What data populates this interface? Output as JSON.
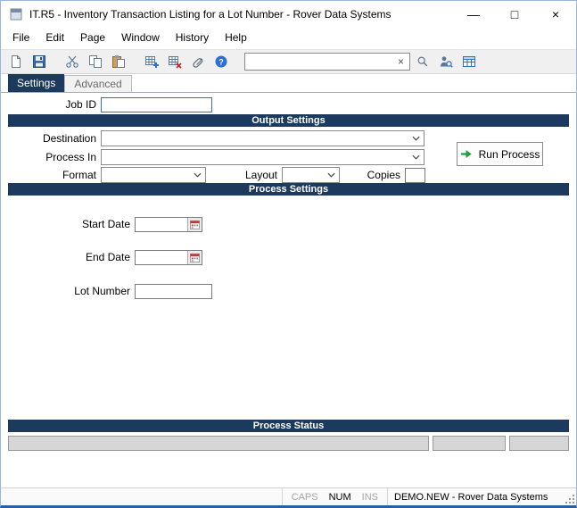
{
  "colors": {
    "header_navy": "#1B3A5E",
    "run_arrow_green": "#1E9E40"
  },
  "window": {
    "title": "IT.R5 - Inventory Transaction Listing for a Lot Number - Rover Data Systems",
    "minimize_glyph": "—",
    "maximize_glyph": "□",
    "close_glyph": "×"
  },
  "menu": {
    "items": [
      "File",
      "Edit",
      "Page",
      "Window",
      "History",
      "Help"
    ]
  },
  "toolbar": {
    "search_value": ""
  },
  "tabs": {
    "settings": "Settings",
    "advanced": "Advanced"
  },
  "form": {
    "job_id": {
      "label": "Job ID",
      "value": ""
    },
    "output_section_title": "Output Settings",
    "destination": {
      "label": "Destination",
      "value": ""
    },
    "process_in": {
      "label": "Process In",
      "value": ""
    },
    "run_process_label": "Run Process",
    "format": {
      "label": "Format",
      "value": ""
    },
    "layout": {
      "label": "Layout",
      "value": ""
    },
    "copies": {
      "label": "Copies",
      "value": ""
    },
    "process_section_title": "Process Settings",
    "start_date": {
      "label": "Start Date",
      "value": ""
    },
    "end_date": {
      "label": "End Date",
      "value": ""
    },
    "lot_number": {
      "label": "Lot Number",
      "value": ""
    },
    "status_section_title": "Process Status",
    "status_fields": [
      "",
      "",
      ""
    ]
  },
  "statusbar": {
    "caps": "CAPS",
    "num": "NUM",
    "ins": "INS",
    "session": "DEMO.NEW - Rover Data Systems"
  }
}
